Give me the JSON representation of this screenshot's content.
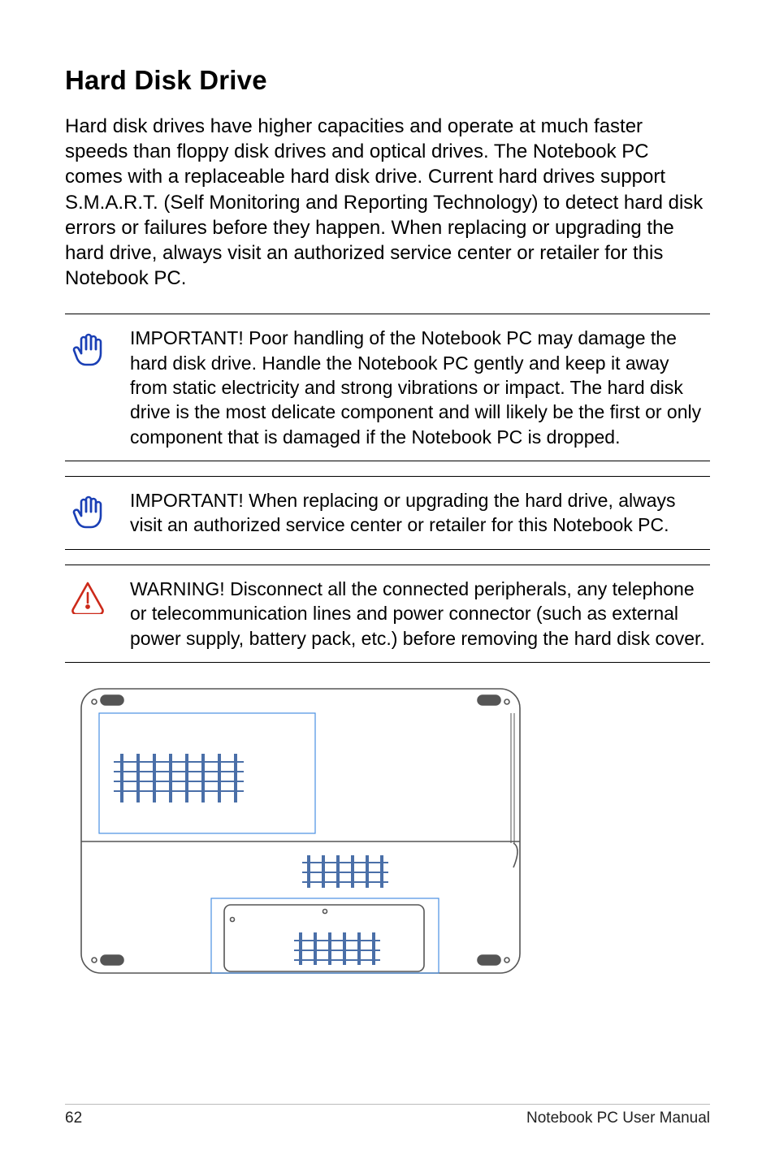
{
  "title": "Hard Disk Drive",
  "body": "Hard disk drives have higher capacities and operate at much faster speeds than floppy disk drives and optical drives. The Notebook PC comes with a replaceable hard disk drive. Current hard drives support S.M.A.R.T. (Self Monitoring and Reporting Technology) to detect hard disk errors or failures before they happen. When replacing or upgrading the hard drive, always visit an authorized service center or retailer for this Notebook PC.",
  "callouts": [
    {
      "icon": "hand",
      "text": "IMPORTANT!  Poor handling of the Notebook PC may damage the hard disk drive. Handle the Notebook PC gently and keep it away from static electricity and strong vibrations or impact. The hard disk drive is the most delicate component and will likely be the first or only component that is damaged if the Notebook PC is dropped."
    },
    {
      "icon": "hand",
      "text": "IMPORTANT!  When replacing or upgrading the hard drive, always visit an authorized service center or retailer for this Notebook PC."
    },
    {
      "icon": "warning",
      "text": "WARNING! Disconnect all the connected peripherals, any telephone or telecommunication lines and power connector (such as external power supply, battery pack, etc.) before removing the hard disk cover."
    }
  ],
  "footer": {
    "page": "62",
    "label": "Notebook PC User Manual"
  }
}
